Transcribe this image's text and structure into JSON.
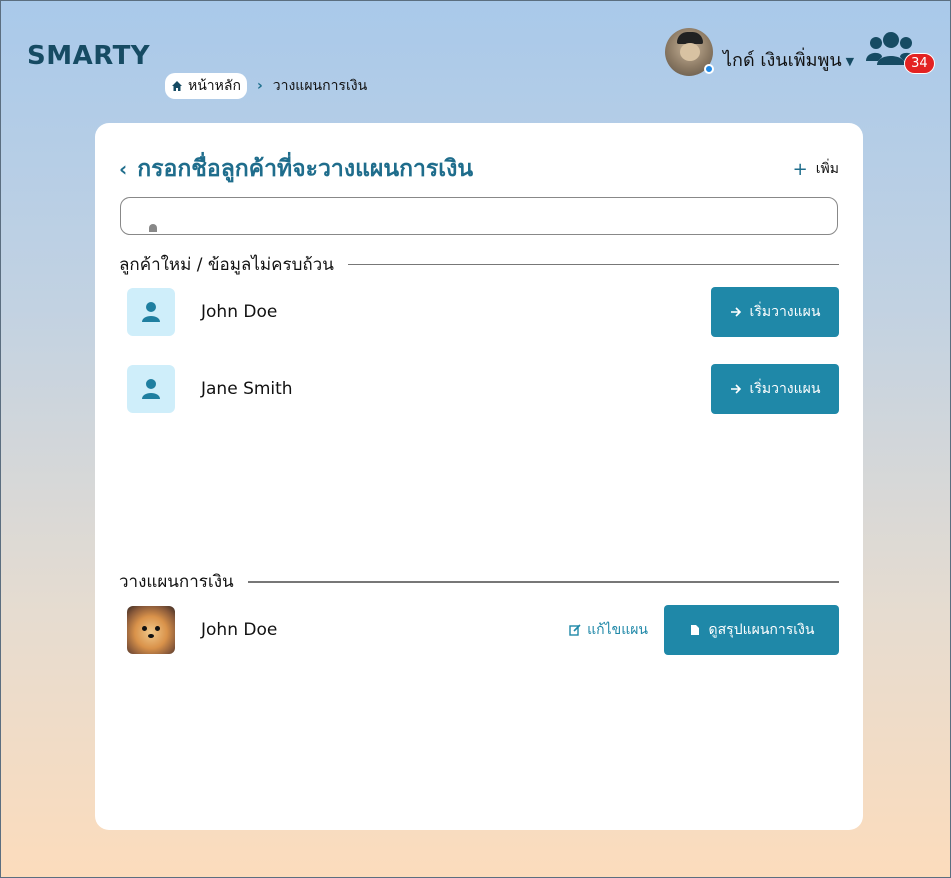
{
  "app": {
    "logo": "SMARTY"
  },
  "breadcrumb": {
    "home": "หน้าหลัก",
    "current": "วางแผนการเงิน"
  },
  "user": {
    "name": "ไกด์ เงินเพิ่มพูน",
    "notifications": "34"
  },
  "card": {
    "title": "กรอกชื่อลูกค้าที่จะวางแผนการเงิน",
    "add_label": "เพิ่ม",
    "search": {
      "value": "",
      "placeholder": ""
    }
  },
  "sections": {
    "new_customers": {
      "title": "ลูกค้าใหม่ / ข้อมูลไม่ครบถ้วน",
      "items": [
        {
          "name": "John Doe",
          "action": "เริ่มวางแผน"
        },
        {
          "name": "Jane Smith",
          "action": "เริ่มวางแผน"
        }
      ]
    },
    "planned": {
      "title": "วางแผนการเงิน",
      "items": [
        {
          "name": "John Doe",
          "edit": "แก้ไขแผน",
          "summary": "ดูสรุปแผนการเงิน"
        }
      ]
    }
  },
  "colors": {
    "brand": "#164b63",
    "accent": "#1f88a8",
    "badge": "#e32222",
    "tile": "#cfeefa"
  }
}
